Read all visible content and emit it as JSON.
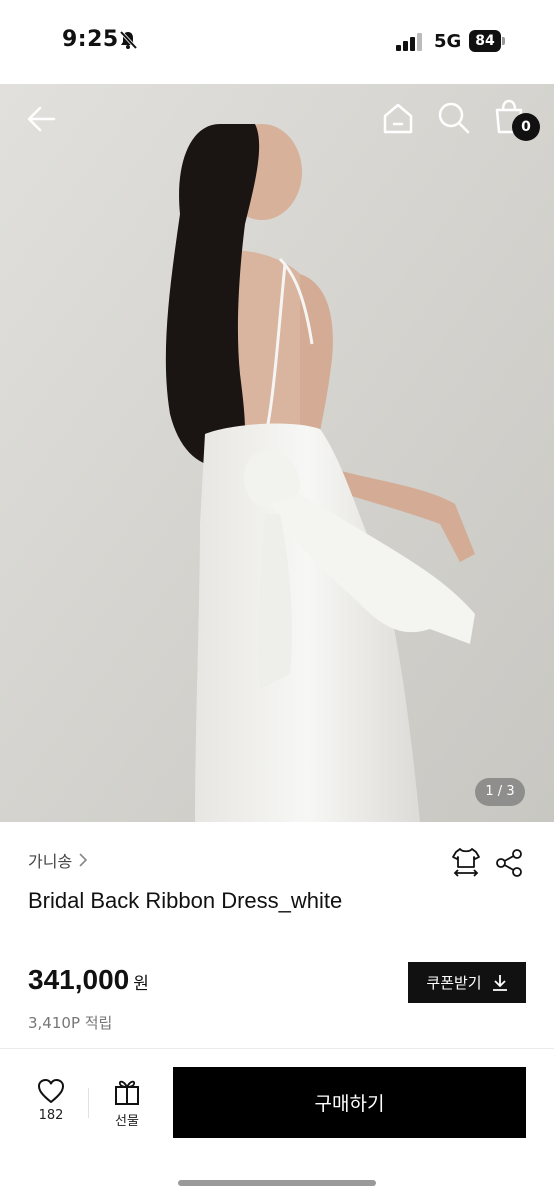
{
  "status_bar": {
    "time": "9:25",
    "network": "5G",
    "battery": "84"
  },
  "header": {
    "cart_count": "0"
  },
  "gallery": {
    "indicator": "1 / 3"
  },
  "product": {
    "brand": "가니송",
    "name": "Bridal Back Ribbon Dress_white",
    "price": "341,000",
    "currency": "원",
    "points": "3,410P 적립",
    "coupon_label": "쿠폰받기"
  },
  "bottom_bar": {
    "wish_count": "182",
    "gift_label": "선물",
    "buy_label": "구매하기"
  },
  "icons": {
    "back": "arrow-left-icon",
    "home": "home-icon",
    "search": "search-icon",
    "cart": "shopping-bag-icon",
    "size": "size-guide-icon",
    "share": "share-icon",
    "wish": "heart-icon",
    "gift": "gift-icon",
    "download": "download-icon"
  }
}
